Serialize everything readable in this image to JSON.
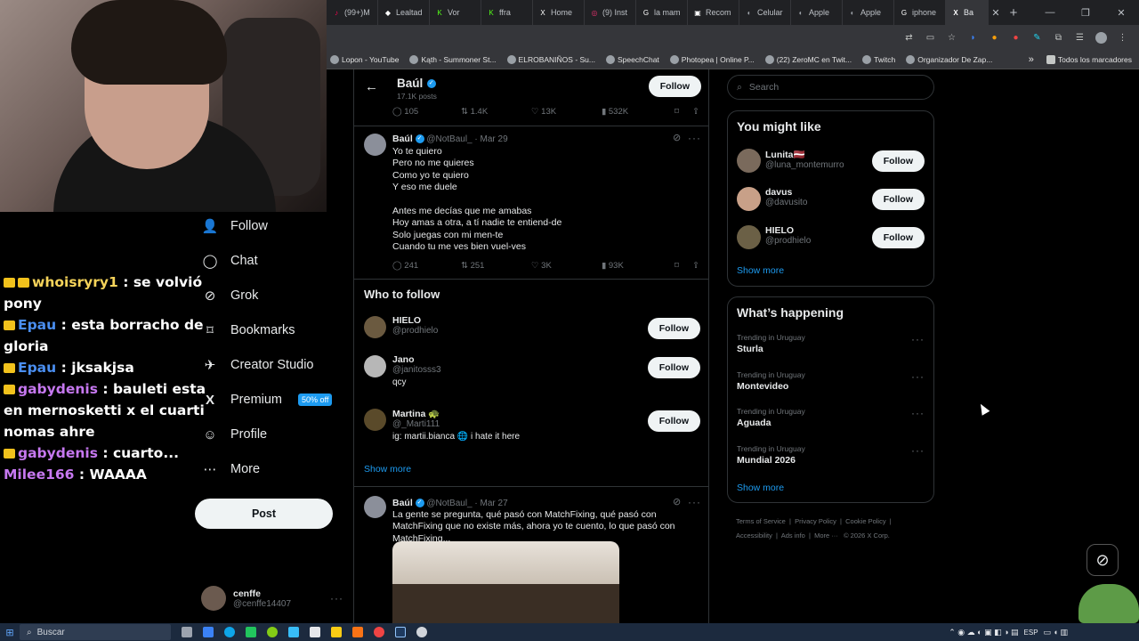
{
  "browser": {
    "tabs": [
      {
        "title": "(99+)M",
        "color": "#ff0050",
        "glyph": "♪"
      },
      {
        "title": "Lealtad",
        "color": "#ffffff",
        "glyph": "◆"
      },
      {
        "title": "Vor",
        "color": "#53fc18",
        "glyph": "K"
      },
      {
        "title": "ffra",
        "color": "#53fc18",
        "glyph": "K"
      },
      {
        "title": "Home",
        "color": "#ffffff",
        "glyph": "X"
      },
      {
        "title": "(9) Inst",
        "color": "#e1306c",
        "glyph": "◎"
      },
      {
        "title": "la mam",
        "color": "#ffffff",
        "glyph": "G"
      },
      {
        "title": "Recom",
        "color": "#ffffff",
        "glyph": "▣"
      },
      {
        "title": "Celular",
        "color": "#9aa0a6",
        "glyph": "◐"
      },
      {
        "title": "Apple",
        "color": "#9aa0a6",
        "glyph": "◐"
      },
      {
        "title": "Apple",
        "color": "#9aa0a6",
        "glyph": "◐"
      },
      {
        "title": "iphone",
        "color": "#ffffff",
        "glyph": "G"
      }
    ],
    "active_tab": {
      "title": "Ba",
      "glyph": "X"
    },
    "tab_close": "✕",
    "new_tab": "+",
    "window_controls": {
      "minimize": "—",
      "maximize": "❐",
      "close": "✕"
    },
    "bookmarks": [
      "Lopon - YouTube",
      "Kąth - Summoner St...",
      "ELROBANIÑOS - Su...",
      "SpeechChat",
      "Photopea | Online P...",
      "(22) ZeroMC en Twit...",
      "Twitch",
      "Organizador De Zap..."
    ],
    "bookmarks_more": "»",
    "all_bookmarks": "Todos los marcadores"
  },
  "chat": [
    {
      "user": "whoisryry1",
      "msg": ": se volvió pony",
      "color": "u1",
      "badges": 2
    },
    {
      "user": "Epau",
      "msg": ": esta borracho de gloria",
      "color": "u2",
      "badges": 1
    },
    {
      "user": "Epau",
      "msg": ": jksakjsa",
      "color": "u2",
      "badges": 1
    },
    {
      "user": "gabydenis",
      "msg": ": bauleti esta en mernosketti x el cuarti nomas ahre",
      "color": "u3",
      "badges": 1
    },
    {
      "user": "gabydenis",
      "msg": ": cuarto...",
      "color": "u3",
      "badges": 1
    },
    {
      "user": "Milee166",
      "msg": ": WAAAA",
      "color": "u3",
      "badges": 0
    }
  ],
  "nav": {
    "follow": "Follow",
    "chat": "Chat",
    "grok": "Grok",
    "bookmarks": "Bookmarks",
    "creator_studio": "Creator Studio",
    "premium": "Premium",
    "premium_promo": "50% off",
    "profile": "Profile",
    "more": "More",
    "post": "Post",
    "account_name": "cenffe",
    "account_handle": "@cenffe14407"
  },
  "profile_header": {
    "name": "Baúl",
    "posts": "17.1K posts",
    "follow": "Follow"
  },
  "tweet_top_actions": {
    "replies": "105",
    "retweets": "1.4K",
    "likes": "13K",
    "views": "532K"
  },
  "tweet1": {
    "name": "Baúl",
    "handle": "@NotBaul_",
    "date": "· Mar 29",
    "text": "Yo te quiero\nPero no me quieres\nComo yo te quiero\nY eso me duele\n\nAntes me decías que me amabas\nHoy amas a otra, a tí nadie te entiend-de\nSolo juegas con mi men-te\nCuando tu me ves bien vuel-ves",
    "replies": "241",
    "retweets": "251",
    "likes": "3K",
    "views": "93K"
  },
  "who_to_follow": {
    "title": "Who to follow",
    "users": [
      {
        "name": "HIELO",
        "handle": "@prodhielo",
        "bio": "",
        "follow": "Follow"
      },
      {
        "name": "Jano",
        "handle": "@janitosss3",
        "bio": "qcy",
        "follow": "Follow"
      },
      {
        "name": "Martina 🐢",
        "handle": "@_Marti111",
        "bio": "ig: martii.bianca 🌐 i hate it here",
        "follow": "Follow"
      }
    ],
    "show_more": "Show more"
  },
  "tweet2": {
    "name": "Baúl",
    "handle": "@NotBaul_",
    "date": "· Mar 27",
    "text": "La gente se pregunta, qué pasó con MatchFixing, qué pasó con MatchFixing que no existe más, ahora yo te cuento, lo que pasó con MatchFixing..."
  },
  "search": {
    "placeholder": "Search"
  },
  "you_might_like": {
    "title": "You might like",
    "users": [
      {
        "name": "Lunita🇱🇻",
        "handle": "@luna_montemurro",
        "follow": "Follow"
      },
      {
        "name": "davus",
        "handle": "@davusito",
        "follow": "Follow"
      },
      {
        "name": "HIELO",
        "handle": "@prodhielo",
        "follow": "Follow"
      }
    ],
    "show_more": "Show more"
  },
  "whats_happening": {
    "title": "What’s happening",
    "trends": [
      {
        "category": "Trending in Uruguay",
        "name": "Sturla"
      },
      {
        "category": "Trending in Uruguay",
        "name": "Montevideo"
      },
      {
        "category": "Trending in Uruguay",
        "name": "Aguada"
      },
      {
        "category": "Trending in Uruguay",
        "name": "Mundial 2026"
      }
    ],
    "show_more": "Show more"
  },
  "footer": {
    "terms": "Terms of Service",
    "privacy": "Privacy Policy",
    "cookie": "Cookie Policy",
    "accessibility": "Accessibility",
    "ads": "Ads info",
    "more": "More ···",
    "copyright": "© 2026 X Corp."
  },
  "taskbar": {
    "search_placeholder": "Buscar",
    "lang": "ESP"
  }
}
